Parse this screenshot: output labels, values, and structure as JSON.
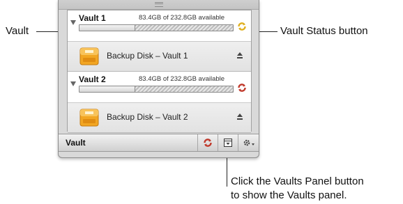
{
  "callouts": {
    "vault": "Vault",
    "status_button": "Vault Status button",
    "panel_button_line1": "Click the Vaults Panel button",
    "panel_button_line2": "to show the Vaults panel."
  },
  "vaults": [
    {
      "name": "Vault 1",
      "availability": "83.4GB of 232.8GB available",
      "used_fraction": 0.36,
      "status_color": "#e0b020",
      "disk": "Backup Disk – Vault 1"
    },
    {
      "name": "Vault 2",
      "availability": "83.4GB of 232.8GB available",
      "used_fraction": 0.36,
      "status_color": "#c0392b",
      "disk": "Backup Disk – Vault 2"
    }
  ],
  "bottom_bar": {
    "title": "Vault",
    "buttons": [
      "sync-status-icon",
      "vaults-panel-icon",
      "gear-menu-icon"
    ]
  },
  "colors": {
    "status_yellow": "#e0b020",
    "status_red": "#c0392b"
  }
}
